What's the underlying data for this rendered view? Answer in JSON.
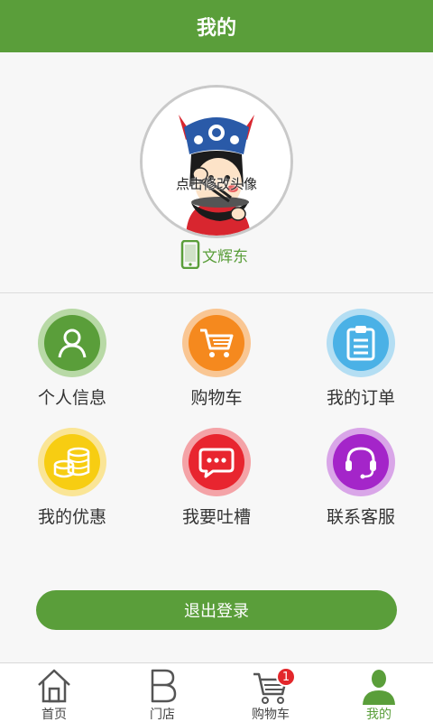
{
  "header": {
    "title": "我的"
  },
  "profile": {
    "avatar_caption": "点击修改头像",
    "username": "文辉东",
    "phone_icon": "mobile-phone-icon"
  },
  "menu": [
    {
      "label": "个人信息",
      "icon": "person-icon",
      "color": "#5a9e3a",
      "ring": "#b8d9a6"
    },
    {
      "label": "购物车",
      "icon": "cart-icon",
      "color": "#f5891e",
      "ring": "#f9c693"
    },
    {
      "label": "我的订单",
      "icon": "clipboard-icon",
      "color": "#4ab1e6",
      "ring": "#b4def3"
    },
    {
      "label": "我的优惠",
      "icon": "coins-icon",
      "color": "#f7cd12",
      "ring": "#fae596"
    },
    {
      "label": "我要吐槽",
      "icon": "chat-bubble-icon",
      "color": "#e8252f",
      "ring": "#f4a3a7"
    },
    {
      "label": "联系客服",
      "icon": "headset-icon",
      "color": "#a425c9",
      "ring": "#d9a6e8"
    }
  ],
  "logout": {
    "label": "退出登录"
  },
  "tabs": [
    {
      "label": "首页",
      "icon": "home-icon"
    },
    {
      "label": "门店",
      "icon": "store-b-icon"
    },
    {
      "label": "购物车",
      "icon": "cart-icon",
      "badge": "1"
    },
    {
      "label": "我的",
      "icon": "user-icon",
      "active": true
    }
  ],
  "colors": {
    "brand_green": "#5a9e3a",
    "badge_red": "#e3272b"
  }
}
